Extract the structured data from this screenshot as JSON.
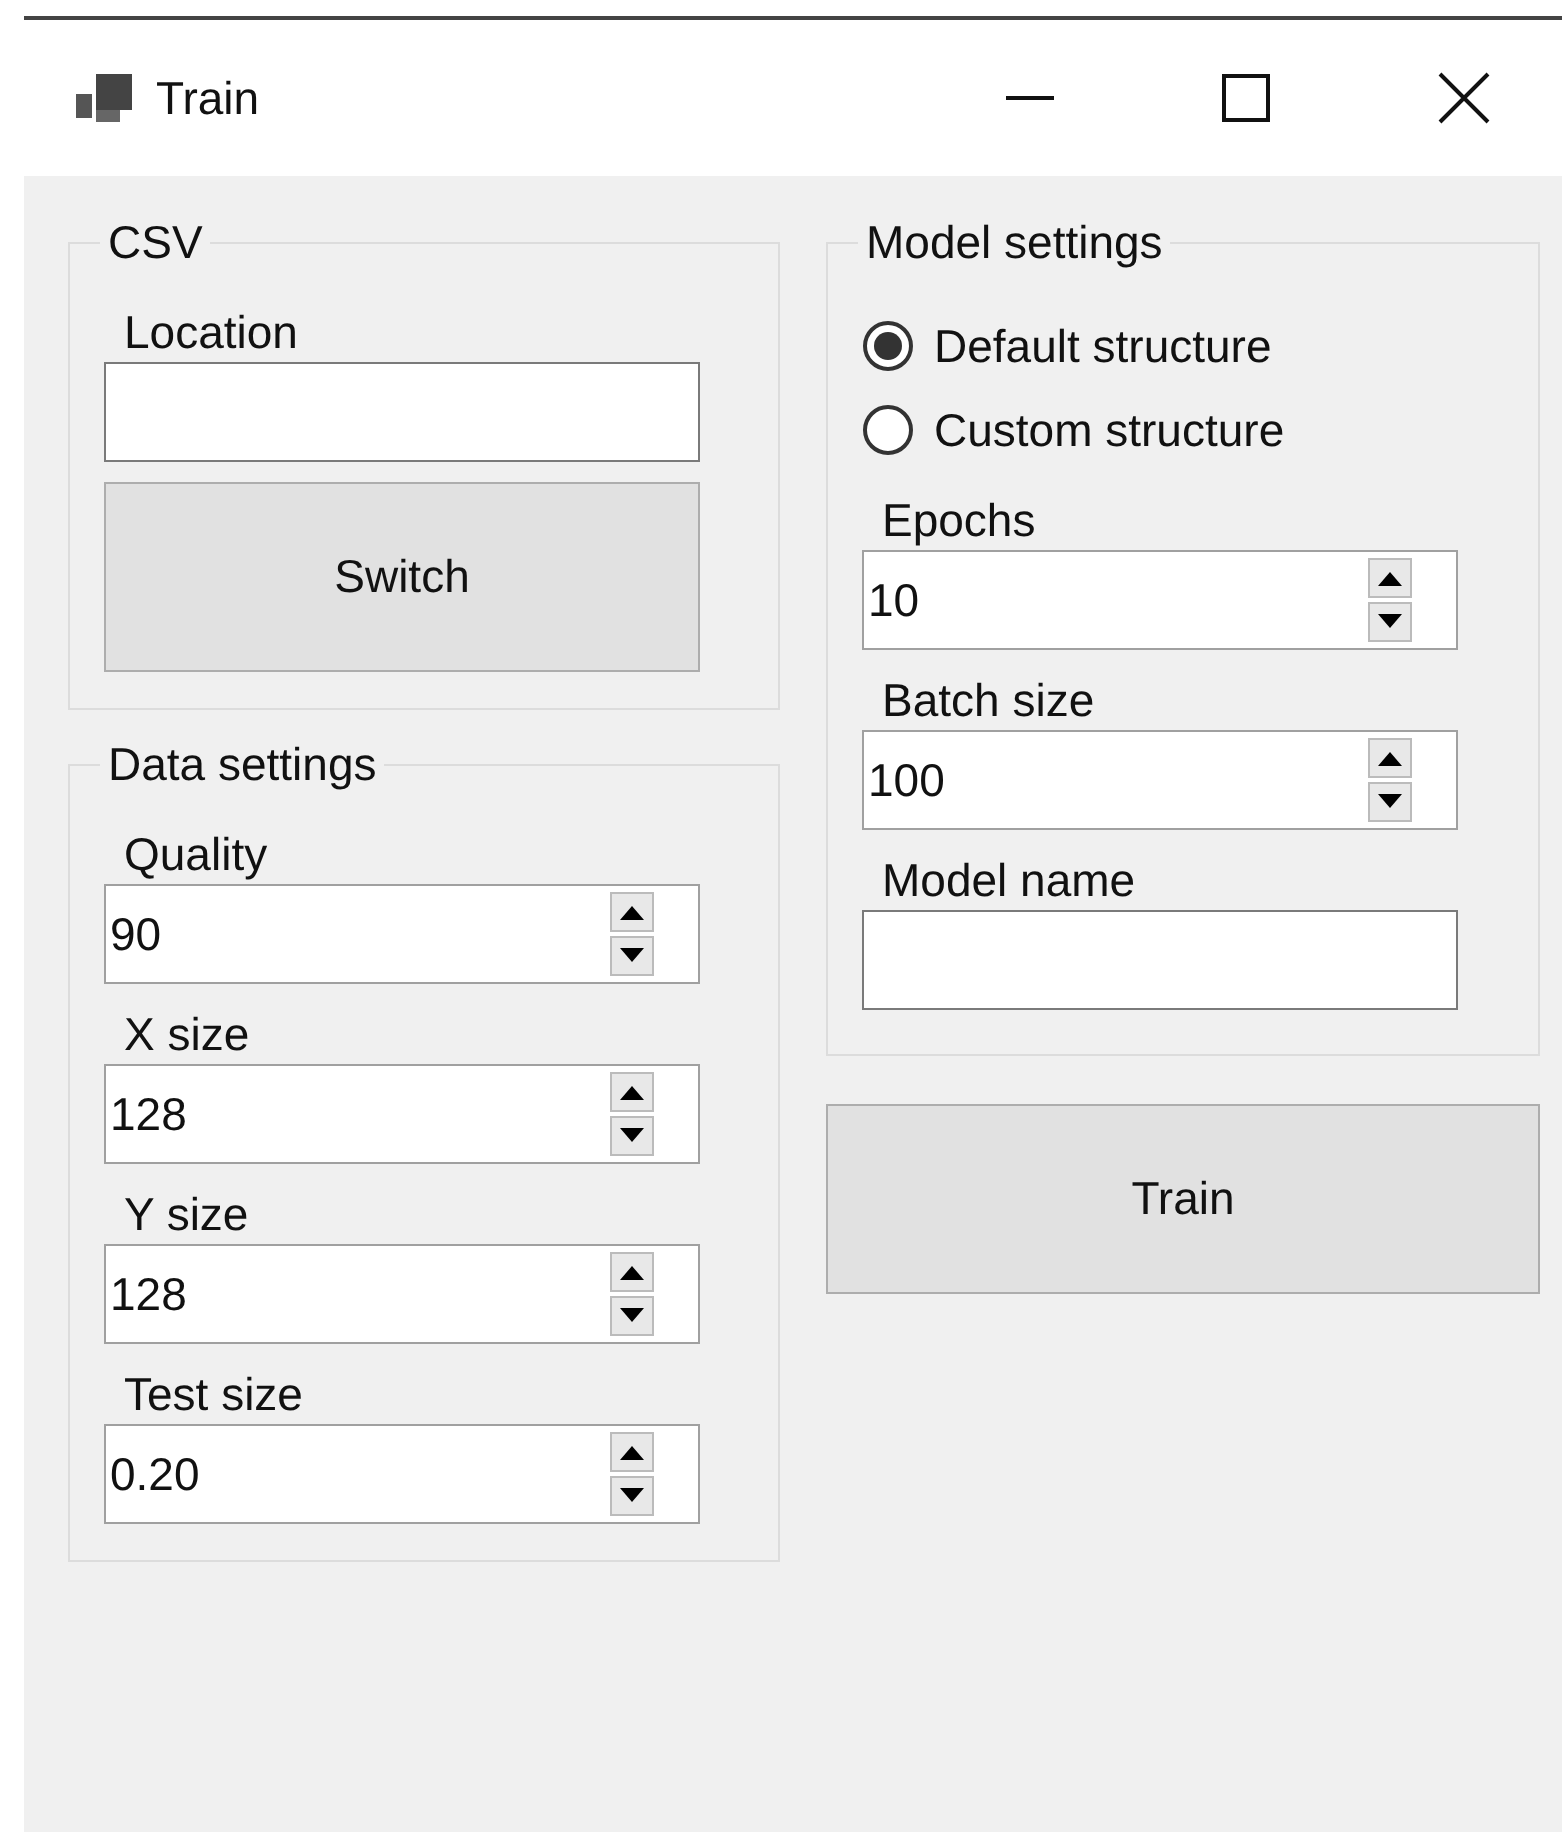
{
  "window": {
    "title": "Train"
  },
  "left_groups": [
    {
      "title": "CSV",
      "items": [
        {
          "kind": "text",
          "label": "Location",
          "value": ""
        },
        {
          "kind": "button",
          "label": "Switch"
        }
      ]
    },
    {
      "title": "Data settings",
      "items": [
        {
          "kind": "spinner",
          "label": "Quality",
          "value": "90"
        },
        {
          "kind": "spinner",
          "label": "X size",
          "value": "128"
        },
        {
          "kind": "spinner",
          "label": "Y size",
          "value": "128"
        },
        {
          "kind": "spinner",
          "label": "Test size",
          "value": "0.20"
        }
      ]
    }
  ],
  "model_settings": {
    "title": "Model settings",
    "structure": [
      {
        "label": "Default structure",
        "selected": true
      },
      {
        "label": "Custom structure",
        "selected": false
      }
    ],
    "items": [
      {
        "kind": "spinner",
        "label": "Epochs",
        "value": "10"
      },
      {
        "kind": "spinner",
        "label": "Batch size",
        "value": "100"
      },
      {
        "kind": "text",
        "label": "Model name",
        "value": ""
      }
    ]
  },
  "train_button": "Train"
}
